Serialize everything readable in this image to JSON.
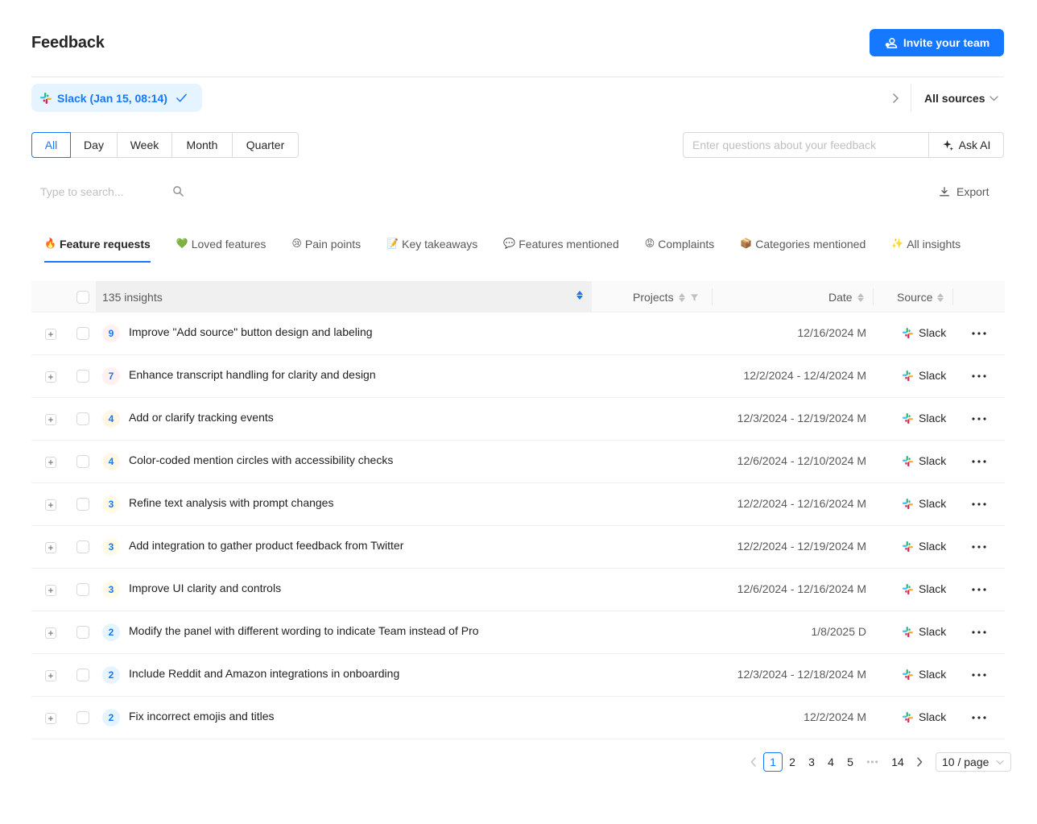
{
  "header": {
    "title": "Feedback",
    "invite_label": "Invite your team"
  },
  "source_chip": {
    "label": "Slack (Jan 15, 08:14)"
  },
  "sources_filter": {
    "label": "All sources"
  },
  "period_tabs": [
    "All",
    "Day",
    "Week",
    "Month",
    "Quarter"
  ],
  "active_period": "All",
  "ask_ai": {
    "placeholder": "Enter questions about your feedback",
    "button_label": "Ask AI"
  },
  "search": {
    "placeholder": "Type to search..."
  },
  "export_label": "Export",
  "insight_tabs": [
    {
      "emoji": "🔥",
      "label": "Feature requests"
    },
    {
      "emoji": "💚",
      "label": "Loved features"
    },
    {
      "emoji": "😢",
      "label": "Pain points"
    },
    {
      "emoji": "📝",
      "label": "Key takeaways"
    },
    {
      "emoji": "💬",
      "label": "Features mentioned"
    },
    {
      "emoji": "😡",
      "label": "Complaints"
    },
    {
      "emoji": "📦",
      "label": "Categories mentioned"
    },
    {
      "emoji": "✨",
      "label": "All insights"
    }
  ],
  "table": {
    "insights_header": "135 insights",
    "projects_header": "Projects",
    "date_header": "Date",
    "source_header": "Source",
    "rows": [
      {
        "count": "9",
        "title": "Improve \"Add source\" button design and labeling",
        "date": "12/16/2024 M",
        "source": "Slack"
      },
      {
        "count": "7",
        "title": "Enhance transcript handling for clarity and design",
        "date": "12/2/2024 - 12/4/2024 M",
        "source": "Slack"
      },
      {
        "count": "4",
        "title": "Add or clarify tracking events",
        "date": "12/3/2024 - 12/19/2024 M",
        "source": "Slack"
      },
      {
        "count": "4",
        "title": "Color-coded mention circles with accessibility checks",
        "date": "12/6/2024 - 12/10/2024 M",
        "source": "Slack"
      },
      {
        "count": "3",
        "title": "Refine text analysis with prompt changes",
        "date": "12/2/2024 - 12/16/2024 M",
        "source": "Slack"
      },
      {
        "count": "3",
        "title": "Add integration to gather product feedback from Twitter",
        "date": "12/2/2024 - 12/19/2024 M",
        "source": "Slack"
      },
      {
        "count": "3",
        "title": "Improve UI clarity and controls",
        "date": "12/6/2024 - 12/16/2024 M",
        "source": "Slack"
      },
      {
        "count": "2",
        "title": "Modify the panel with different wording to indicate Team instead of Pro",
        "date": "1/8/2025 D",
        "source": "Slack"
      },
      {
        "count": "2",
        "title": "Include Reddit and Amazon integrations in onboarding",
        "date": "12/3/2024 - 12/18/2024 M",
        "source": "Slack"
      },
      {
        "count": "2",
        "title": "Fix incorrect emojis and titles",
        "date": "12/2/2024 M",
        "source": "Slack"
      }
    ]
  },
  "badge_colors": {
    "9": {
      "bg": "#fff1f0",
      "fg": "#1677ff"
    },
    "7": {
      "bg": "#fff1f0",
      "fg": "#1677ff"
    },
    "4": {
      "bg": "#fff7e6",
      "fg": "#1677ff"
    },
    "3": {
      "bg": "#fffbe6",
      "fg": "#1677ff"
    },
    "2": {
      "bg": "#e6f4ff",
      "fg": "#1677ff"
    }
  },
  "pagination": {
    "pages": [
      "1",
      "2",
      "3",
      "4",
      "5"
    ],
    "last_page": "14",
    "current": "1",
    "page_size_label": "10 / page"
  },
  "colors": {
    "accent": "#1677ff",
    "chip_bg": "#e6f4ff"
  }
}
